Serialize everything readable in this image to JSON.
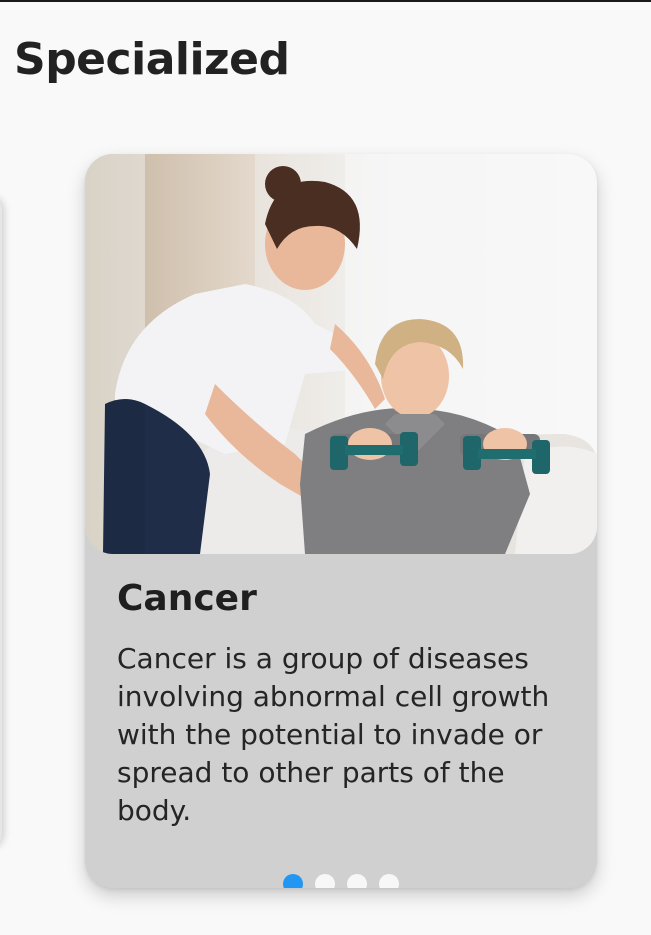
{
  "header": {
    "title": "Specialized"
  },
  "card": {
    "title": "Cancer",
    "description": "Cancer is a group of diseases involving abnormal cell growth with the potential to invade or spread to other parts of the body.",
    "image_alt": "Nurse helping an elderly woman exercise with dumbbells"
  },
  "carousel": {
    "page_count": 4,
    "active_index": 0,
    "active_color": "#2196f3",
    "inactive_color": "#f7f7f7"
  }
}
